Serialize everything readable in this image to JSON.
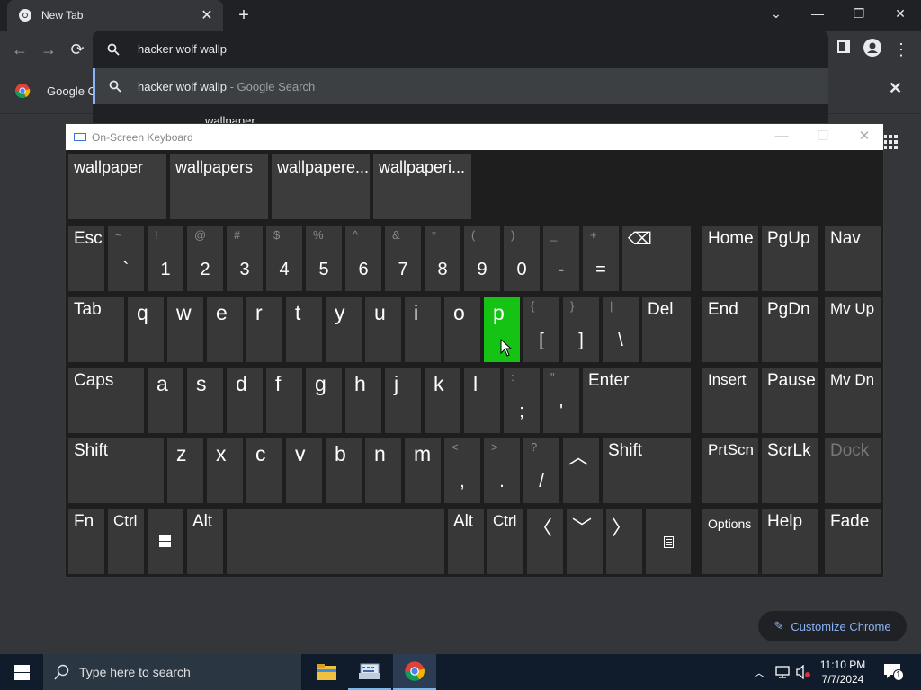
{
  "browser": {
    "tab_title": "New Tab",
    "omnibox_text": "hacker wolf wallp",
    "suggestion_query": "hacker wolf wallp",
    "suggestion_suffix": " - Google Search",
    "suggestion2_partial": "wallpaper",
    "bookmark_label": "Google C",
    "customize_label": "Customize Chrome"
  },
  "osk": {
    "title": "On-Screen Keyboard",
    "predictions": [
      "wallpaper",
      "wallpapers",
      "wallpapere...",
      "wallpaperi..."
    ],
    "keys": {
      "esc": "Esc",
      "tab": "Tab",
      "caps": "Caps",
      "shift": "Shift",
      "shift_r": "Shift",
      "fn": "Fn",
      "ctrl": "Ctrl",
      "alt": "Alt",
      "alt_r": "Alt",
      "ctrl_r": "Ctrl",
      "del": "Del",
      "enter": "Enter",
      "home": "Home",
      "pgup": "PgUp",
      "nav": "Nav",
      "end": "End",
      "pgdn": "PgDn",
      "mvup": "Mv Up",
      "insert": "Insert",
      "pause": "Pause",
      "mvdn": "Mv Dn",
      "prtscn": "PrtScn",
      "scrlk": "ScrLk",
      "dock": "Dock",
      "options": "Options",
      "help": "Help",
      "fade": "Fade"
    },
    "number_row": [
      {
        "up": "~",
        "main": "`"
      },
      {
        "up": "!",
        "main": "1"
      },
      {
        "up": "@",
        "main": "2"
      },
      {
        "up": "#",
        "main": "3"
      },
      {
        "up": "$",
        "main": "4"
      },
      {
        "up": "%",
        "main": "5"
      },
      {
        "up": "^",
        "main": "6"
      },
      {
        "up": "&",
        "main": "7"
      },
      {
        "up": "*",
        "main": "8"
      },
      {
        "up": "(",
        "main": "9"
      },
      {
        "up": ")",
        "main": "0"
      },
      {
        "up": "_",
        "main": "-"
      },
      {
        "up": "+",
        "main": "="
      }
    ],
    "row_q": [
      "q",
      "w",
      "e",
      "r",
      "t",
      "y",
      "u",
      "i",
      "o",
      "p"
    ],
    "row_q_sym": [
      {
        "up": "{",
        "main": "["
      },
      {
        "up": "}",
        "main": "]"
      },
      {
        "up": "|",
        "main": "\\"
      }
    ],
    "row_a": [
      "a",
      "s",
      "d",
      "f",
      "g",
      "h",
      "j",
      "k",
      "l"
    ],
    "row_a_sym": [
      {
        "up": ":",
        "main": ";"
      },
      {
        "up": "\"",
        "main": "'"
      }
    ],
    "row_z": [
      "z",
      "x",
      "c",
      "v",
      "b",
      "n",
      "m"
    ],
    "row_z_sym": [
      {
        "up": "<",
        "main": ","
      },
      {
        "up": ">",
        "main": "."
      },
      {
        "up": "?",
        "main": "/"
      }
    ],
    "active_key": "p"
  },
  "taskbar": {
    "search_placeholder": "Type here to search",
    "time": "11:10 PM",
    "date": "7/7/2024",
    "notif_count": "1"
  }
}
